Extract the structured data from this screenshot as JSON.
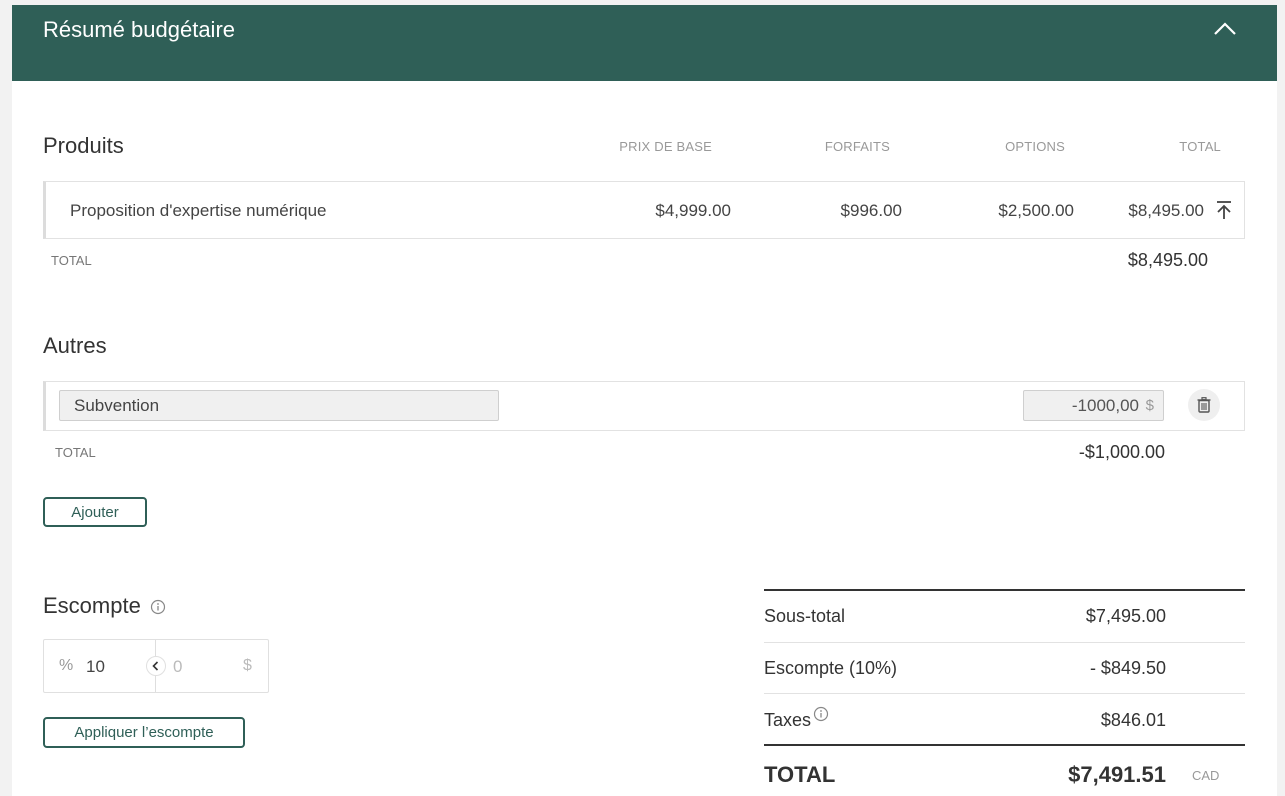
{
  "header": {
    "title": "Résumé budgétaire"
  },
  "products": {
    "title": "Produits",
    "columns": {
      "base_price": "PRIX DE BASE",
      "packages": "FORFAITS",
      "options": "OPTIONS",
      "total": "TOTAL"
    },
    "rows": [
      {
        "name": "Proposition d'expertise numérique",
        "base_price": "$4,999.00",
        "packages": "$996.00",
        "options": "$2,500.00",
        "total": "$8,495.00"
      }
    ],
    "total_label": "TOTAL",
    "total_value": "$8,495.00"
  },
  "others": {
    "title": "Autres",
    "rows": [
      {
        "name": "Subvention",
        "amount": "-1000,00",
        "unit": "$"
      }
    ],
    "total_label": "TOTAL",
    "total_value": "-$1,000.00",
    "add_label": "Ajouter"
  },
  "discount": {
    "title": "Escompte",
    "percent_symbol": "%",
    "percent_value": "10",
    "amount_placeholder": "0",
    "amount_symbol": "$",
    "apply_label": "Appliquer l’escompte"
  },
  "summary": {
    "subtotal_label": "Sous-total",
    "subtotal_value": "$7,495.00",
    "discount_label": "Escompte (10%)",
    "discount_value": "- $849.50",
    "taxes_label": "Taxes",
    "taxes_value": "$846.01",
    "total_label": "TOTAL",
    "total_value": "$7,491.51",
    "currency": "CAD"
  },
  "colors": {
    "brand": "#2f5f57",
    "muted": "#999999"
  }
}
